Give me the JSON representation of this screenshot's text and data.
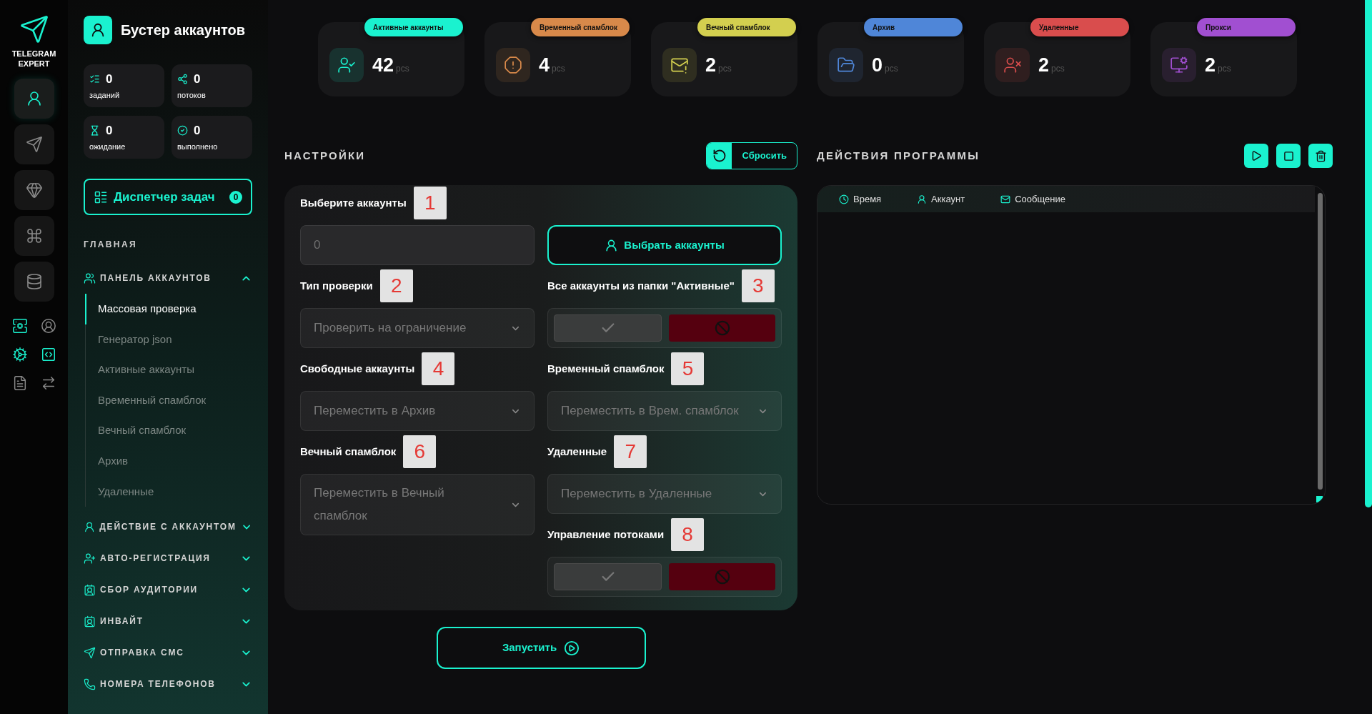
{
  "rail": {
    "logo": "TELEGRAM EXPERT",
    "nav": [
      {
        "selected": true
      },
      {
        "selected": false
      },
      {
        "selected": false
      },
      {
        "selected": false
      },
      {
        "selected": false
      }
    ],
    "tools": [
      {
        "active": true
      },
      {
        "active": false
      },
      {
        "active": true
      },
      {
        "active": true
      },
      {
        "active": false
      },
      {
        "active": false
      }
    ]
  },
  "sidebar": {
    "title": "Бустер аккаунтов",
    "stats": [
      {
        "value": "0",
        "label": "заданий"
      },
      {
        "value": "0",
        "label": "потоков"
      },
      {
        "value": "0",
        "label": "ожидание"
      },
      {
        "value": "0",
        "label": "выполнено"
      }
    ],
    "task_manager": {
      "label": "Диспетчер задач",
      "count": "0"
    },
    "section": "ГЛАВНАЯ",
    "groups": [
      {
        "label": "ПАНЕЛЬ АККАУНТОВ",
        "expanded": true,
        "children": [
          {
            "label": "Массовая проверка",
            "selected": true
          },
          {
            "label": "Генератор json",
            "selected": false
          },
          {
            "label": "Активные аккаунты",
            "selected": false
          },
          {
            "label": "Временный спамблок",
            "selected": false
          },
          {
            "label": "Вечный спамблок",
            "selected": false
          },
          {
            "label": "Архив",
            "selected": false
          },
          {
            "label": "Удаленные",
            "selected": false
          }
        ]
      },
      {
        "label": "ДЕЙСТВИЕ С АККАУНТОМ",
        "expanded": false
      },
      {
        "label": "АВТО-РЕГИСТРАЦИЯ",
        "expanded": false
      },
      {
        "label": "СБОР АУДИТОРИИ",
        "expanded": false
      },
      {
        "label": "ИНВАЙТ",
        "expanded": false
      },
      {
        "label": "ОТПРАВКА СМС",
        "expanded": false
      },
      {
        "label": "НОМЕРА ТЕЛЕФОНОВ",
        "expanded": false
      }
    ]
  },
  "summary": [
    {
      "label": "Активные аккаунты",
      "color": "#1af2cf",
      "value": "42",
      "unit": "pcs"
    },
    {
      "label": "Временный спамблок",
      "color": "#d8894a",
      "value": "4",
      "unit": "pcs"
    },
    {
      "label": "Вечный спамблок",
      "color": "#d3cf4f",
      "value": "2",
      "unit": "pcs"
    },
    {
      "label": "Архив",
      "color": "#4f86d8",
      "value": "0",
      "unit": "pcs"
    },
    {
      "label": "Удаленные",
      "color": "#d94d4d",
      "value": "2",
      "unit": "pcs"
    },
    {
      "label": "Прокси",
      "color": "#a14fd1",
      "value": "2",
      "unit": "pcs"
    }
  ],
  "settings": {
    "title": "НАСТРОЙКИ",
    "reset": "Сбросить",
    "left": [
      {
        "kind": "input",
        "label": "Выберите аккаунты",
        "marker": "1",
        "placeholder": "0"
      },
      {
        "kind": "select",
        "label": "Тип проверки",
        "marker": "2",
        "value": "Проверить на ограничение"
      },
      {
        "kind": "select",
        "label": "Свободные аккаунты",
        "marker": "4",
        "value": "Переместить в Архив"
      },
      {
        "kind": "select",
        "label": "Вечный спамблок",
        "marker": "6",
        "value": "Переместить в Вечный спамблок"
      }
    ],
    "right": [
      {
        "kind": "button",
        "text": "Выбрать аккаунты"
      },
      {
        "kind": "toggle",
        "label": "Все аккаунты из папки \"Активные\"",
        "marker": "3",
        "enabled": false
      },
      {
        "kind": "select",
        "label": "Временный спамблок",
        "marker": "5",
        "value": "Переместить в Врем. спамблок"
      },
      {
        "kind": "select",
        "label": "Удаленные",
        "marker": "7",
        "value": "Переместить в Удаленные"
      },
      {
        "kind": "toggle",
        "label": "Управление потоками",
        "marker": "8",
        "enabled": false
      }
    ],
    "start": "Запустить"
  },
  "log": {
    "title": "ДЕЙСТВИЯ ПРОГРАММЫ",
    "columns": [
      "Время",
      "Аккаунт",
      "Сообщение"
    ]
  }
}
